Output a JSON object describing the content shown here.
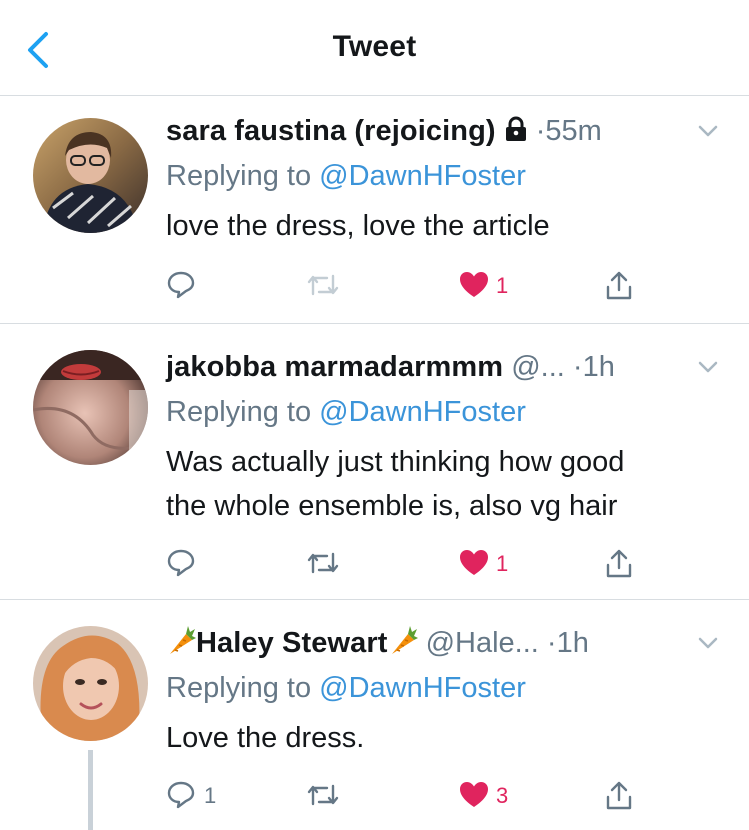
{
  "header": {
    "title": "Tweet",
    "back_icon": "chevron-left-icon"
  },
  "colors": {
    "accent": "#1da1f2",
    "like": "#e0245e",
    "muted": "#657786",
    "text": "#14171a",
    "divider": "#d8dde1"
  },
  "tweets": [
    {
      "display_name": "sara faustina (rejoicing)",
      "protected": true,
      "handle": "",
      "dot": "·",
      "time": "55m",
      "replying_prefix": "Replying to ",
      "replying_to": "@DawnHFoster",
      "text": "love the dress, love the article",
      "reply_count": "",
      "like_count": "1"
    },
    {
      "display_name": "jakobba marmadarmmm",
      "protected": false,
      "handle": "@...",
      "dot": "·",
      "time": "1h",
      "replying_prefix": "Replying to ",
      "replying_to": "@DawnHFoster",
      "text": "Was actually just thinking how good\nthe whole ensemble is, also vg hair",
      "reply_count": "",
      "like_count": "1"
    },
    {
      "display_name": "Haley Stewart",
      "protected": false,
      "handle": "@Hale...",
      "dot": "·",
      "time": "1h",
      "replying_prefix": "Replying to ",
      "replying_to": "@DawnHFoster",
      "text": "Love the dress.",
      "reply_count": "1",
      "like_count": "3"
    }
  ]
}
